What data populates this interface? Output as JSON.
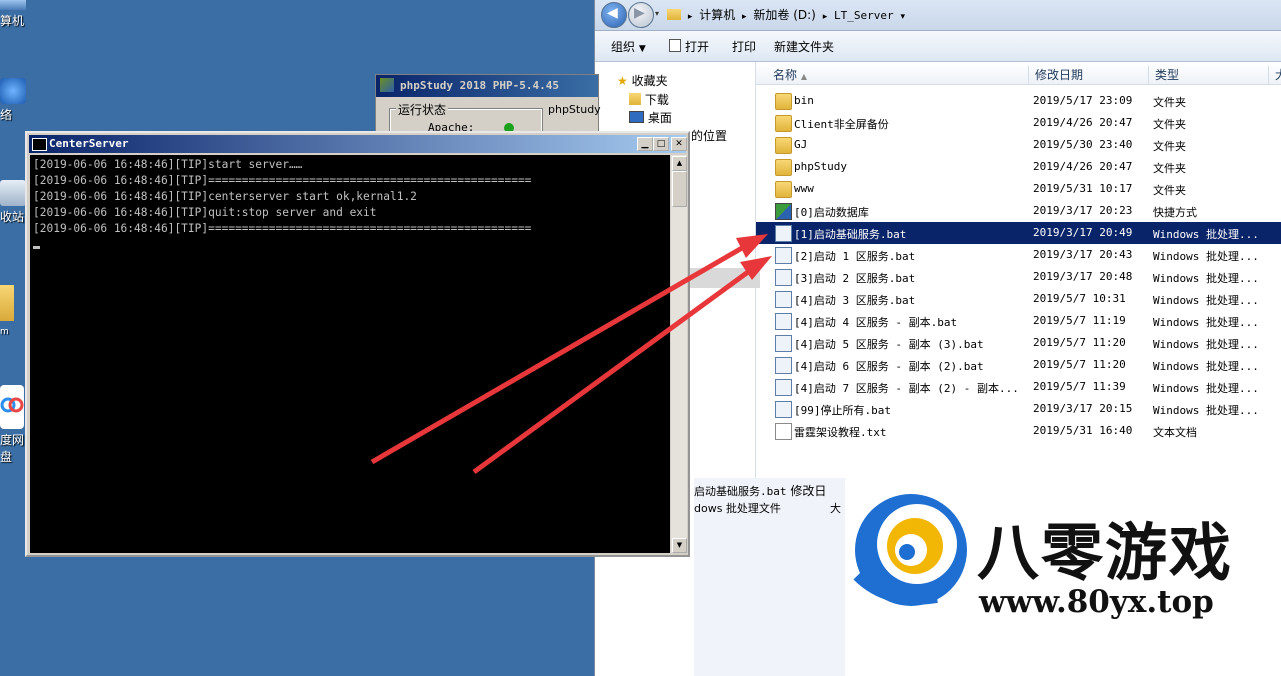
{
  "desktop": {
    "icons": [
      {
        "label": "算机",
        "icon": "computer-icon"
      },
      {
        "label": "络",
        "icon": "network-icon"
      },
      {
        "label": "收站",
        "icon": "recycle-bin-icon"
      },
      {
        "label": "m",
        "icon": "folder-icon"
      },
      {
        "label": "度网盘",
        "icon": "baidu-netdisk-icon"
      }
    ]
  },
  "explorer": {
    "breadcrumb": [
      "计算机",
      "新加卷 (D:)",
      "LT_Server"
    ],
    "toolbar": {
      "organize": "组织",
      "open": "打开",
      "print": "打印",
      "new_folder": "新建文件夹"
    },
    "nav": {
      "favorites": "收藏夹",
      "downloads": "下载",
      "desktop": "桌面",
      "recent": "的位置"
    },
    "columns": {
      "name": "名称",
      "date": "修改日期",
      "type": "类型",
      "size": "大"
    },
    "files": [
      {
        "name": "bin",
        "date": "2019/5/17 23:09",
        "type": "文件夹",
        "icon": "folder-icon"
      },
      {
        "name": "Client非全屏备份",
        "date": "2019/4/26 20:47",
        "type": "文件夹",
        "icon": "folder-icon"
      },
      {
        "name": "GJ",
        "date": "2019/5/30 23:40",
        "type": "文件夹",
        "icon": "folder-icon"
      },
      {
        "name": "phpStudy",
        "date": "2019/4/26 20:47",
        "type": "文件夹",
        "icon": "folder-icon"
      },
      {
        "name": "www",
        "date": "2019/5/31 10:17",
        "type": "文件夹",
        "icon": "folder-icon"
      },
      {
        "name": "[0]启动数据库",
        "date": "2019/3/17 20:23",
        "type": "快捷方式",
        "icon": "shortcut-icon"
      },
      {
        "name": "[1]启动基础服务.bat",
        "date": "2019/3/17 20:49",
        "type": "Windows 批处理...",
        "icon": "batch-file-icon",
        "selected": true
      },
      {
        "name": "[2]启动 1 区服务.bat",
        "date": "2019/3/17 20:43",
        "type": "Windows 批处理...",
        "icon": "batch-file-icon"
      },
      {
        "name": "[3]启动 2 区服务.bat",
        "date": "2019/3/17 20:48",
        "type": "Windows 批处理...",
        "icon": "batch-file-icon"
      },
      {
        "name": "[4]启动 3 区服务.bat",
        "date": "2019/5/7 10:31",
        "type": "Windows 批处理...",
        "icon": "batch-file-icon"
      },
      {
        "name": "[4]启动 4 区服务 - 副本.bat",
        "date": "2019/5/7 11:19",
        "type": "Windows 批处理...",
        "icon": "batch-file-icon"
      },
      {
        "name": "[4]启动 5 区服务 - 副本 (3).bat",
        "date": "2019/5/7 11:20",
        "type": "Windows 批处理...",
        "icon": "batch-file-icon"
      },
      {
        "name": "[4]启动 6 区服务 - 副本 (2).bat",
        "date": "2019/5/7 11:20",
        "type": "Windows 批处理...",
        "icon": "batch-file-icon"
      },
      {
        "name": "[4]启动 7 区服务 - 副本 (2) - 副本...",
        "date": "2019/5/7 11:39",
        "type": "Windows 批处理...",
        "icon": "batch-file-icon"
      },
      {
        "name": "[99]停止所有.bat",
        "date": "2019/3/17 20:15",
        "type": "Windows 批处理...",
        "icon": "batch-file-icon"
      },
      {
        "name": "雷霆架设教程.txt",
        "date": "2019/5/31 16:40",
        "type": "文本文档",
        "icon": "text-file-icon"
      }
    ],
    "details": {
      "name": "启动基础服务.bat",
      "modified_label": "修改日",
      "type": "dows 批处理文件",
      "size_label": "大"
    }
  },
  "phpstudy": {
    "title": "phpStudy 2018   PHP-5.4.45",
    "group_label": "运行状态",
    "apache_label": "Apache:",
    "side_label": "phpStudy"
  },
  "console": {
    "title": "CenterServer",
    "lines": [
      "[2019-06-06 16:48:46][TIP]start server……",
      "[2019-06-06 16:48:46][TIP]================================================",
      "[2019-06-06 16:48:46][TIP]centerserver start ok,kernal1.2",
      "[2019-06-06 16:48:46][TIP]quit:stop server and exit",
      "[2019-06-06 16:48:46][TIP]================================================"
    ]
  },
  "watermark": {
    "title": "八零游戏",
    "url": "www.80yx.top"
  },
  "colors": {
    "selection": "#0a246a",
    "arrow": "#e8373a",
    "desktop": "#3a6ea5"
  }
}
